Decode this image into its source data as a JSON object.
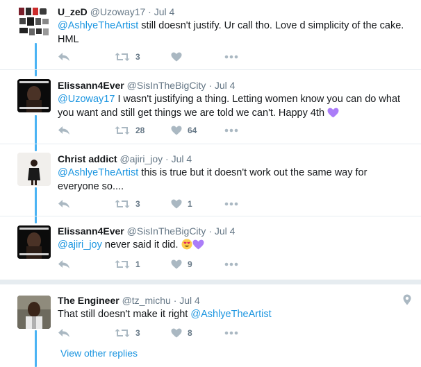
{
  "tweets": [
    {
      "name": "U_zeD",
      "handle": "@Uzoway17",
      "dot": "·",
      "time": "Jul 4",
      "mention": "@AshlyeTheArtist",
      "text": " still doesn't justify. Ur call tho. Love d simplicity of the cake. HML",
      "retweets": "3",
      "likes": ""
    },
    {
      "name": "Elissann4Ever",
      "handle": "@SisInTheBigCity",
      "dot": "·",
      "time": "Jul 4",
      "mention": "@Uzoway17",
      "text": " I wasn't justifying a thing. Letting women know you can do what you want and still get things we are told we can't. Happy 4th",
      "avatar_text": "MAYPOP & DIED",
      "retweets": "28",
      "likes": "64"
    },
    {
      "name": "Christ addict",
      "handle": "@ajiri_joy",
      "dot": "·",
      "time": "Jul 4",
      "mention": "@AshlyeTheArtist",
      "text": " this is true but it doesn't work out the same way for everyone so....",
      "retweets": "3",
      "likes": "1"
    },
    {
      "name": "Elissann4Ever",
      "handle": "@SisInTheBigCity",
      "dot": "·",
      "time": "Jul 4",
      "mention": "@ajiri_joy",
      "text": " never said it did.",
      "avatar_text": "MAYPOP & DIED",
      "retweets": "1",
      "likes": "9"
    },
    {
      "name": "The Engineer",
      "handle": "@tz_michu",
      "dot": "·",
      "time": "Jul 4",
      "pre_text": "That still doesn't make it right ",
      "mention": "@AshlyeTheArtist",
      "retweets": "3",
      "likes": "8"
    }
  ],
  "view_other_replies": "View other replies",
  "colors": {
    "accent": "#1b95e0",
    "thread_line": "#4ab3f4",
    "icon_gray": "#aab8c2",
    "emoji_heart": "#ab7df8"
  }
}
